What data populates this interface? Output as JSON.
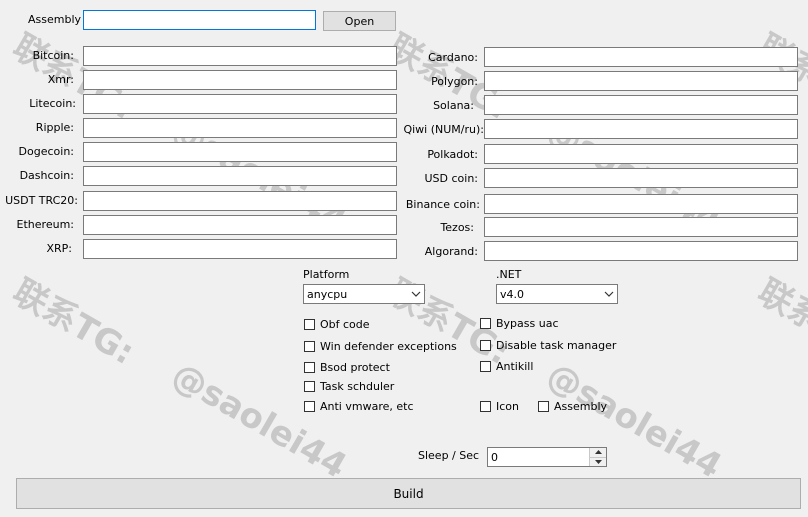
{
  "assembly": {
    "label": "Assembly",
    "value": "",
    "open_label": "Open"
  },
  "left_wallets": [
    {
      "label": "Bitcoin:",
      "value": ""
    },
    {
      "label": "Xmr:",
      "value": ""
    },
    {
      "label": "Litecoin:",
      "value": ""
    },
    {
      "label": "Ripple:",
      "value": ""
    },
    {
      "label": "Dogecoin:",
      "value": ""
    },
    {
      "label": "Dashcoin:",
      "value": ""
    },
    {
      "label": "USDT TRC20:",
      "value": ""
    },
    {
      "label": "Ethereum:",
      "value": ""
    },
    {
      "label": "XRP:",
      "value": ""
    }
  ],
  "right_wallets": [
    {
      "label": "Cardano:",
      "value": ""
    },
    {
      "label": "Polygon:",
      "value": ""
    },
    {
      "label": "Solana:",
      "value": ""
    },
    {
      "label": "Qiwi (NUM/ru):",
      "value": ""
    },
    {
      "label": "Polkadot:",
      "value": ""
    },
    {
      "label": "USD coin:",
      "value": ""
    },
    {
      "label": "Binance coin:",
      "value": ""
    },
    {
      "label": "Tezos:",
      "value": ""
    },
    {
      "label": "Algorand:",
      "value": ""
    }
  ],
  "platform": {
    "label": "Platform",
    "selected": "anycpu"
  },
  "dotnet": {
    "label": ".NET",
    "selected": "v4.0"
  },
  "options_left": [
    {
      "label": "Obf code",
      "checked": false
    },
    {
      "label": "Win defender exceptions",
      "checked": false
    },
    {
      "label": "Bsod protect",
      "checked": false
    },
    {
      "label": "Task schduler",
      "checked": false
    },
    {
      "label": "Anti vmware, etc",
      "checked": false
    }
  ],
  "options_right": [
    {
      "label": "Bypass  uac",
      "checked": false
    },
    {
      "label": "Disable task manager",
      "checked": false
    },
    {
      "label": "Antikill",
      "checked": false
    },
    {
      "label": "Icon",
      "checked": false
    },
    {
      "label": "Assembly",
      "checked": false
    }
  ],
  "sleep": {
    "label": "Sleep / Sec",
    "value": "0"
  },
  "build_label": "Build",
  "watermark": {
    "line1": "联系TG:",
    "line2": "@saolei44"
  }
}
